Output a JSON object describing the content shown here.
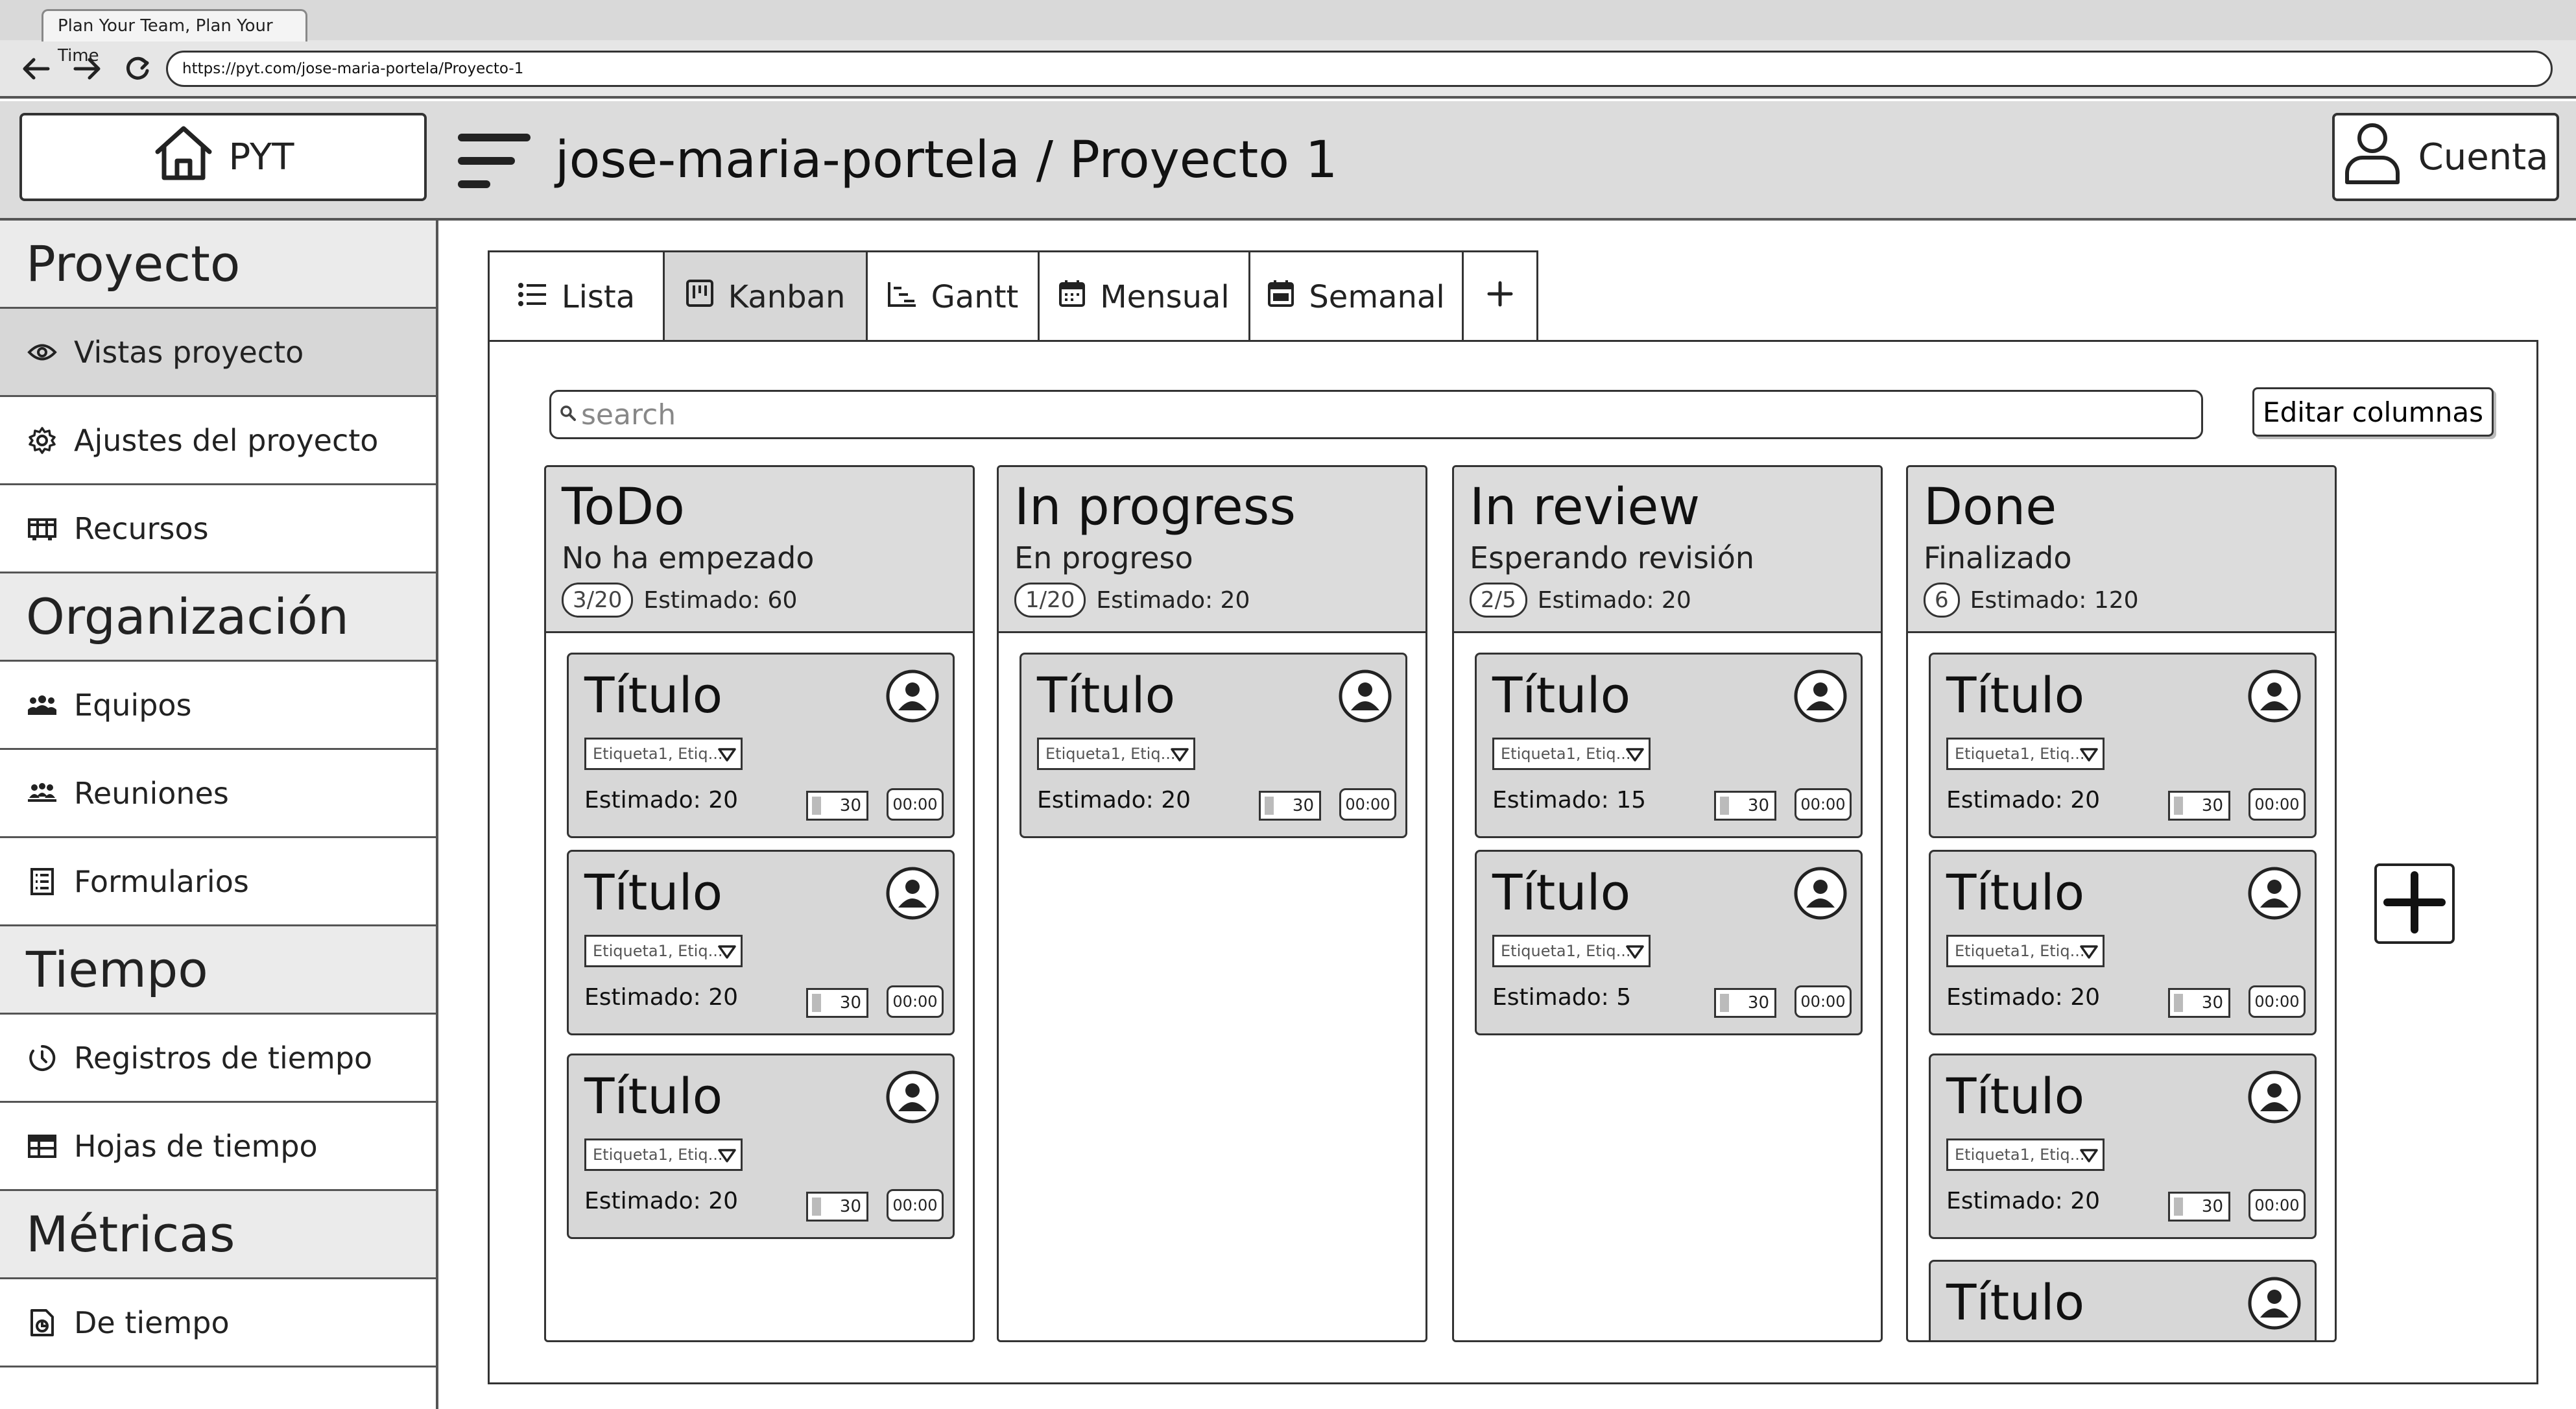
{
  "browser": {
    "tab_title": "Plan Your Team, Plan Your Time",
    "url": "https://pyt.com/jose-maria-portela/Proyecto-1"
  },
  "header": {
    "home_label": "PYT",
    "breadcrumb": "jose-maria-portela / Proyecto 1",
    "account_label": "Cuenta"
  },
  "sidebar": {
    "sections": [
      {
        "title": "Proyecto",
        "items": [
          {
            "label": "Vistas proyecto",
            "icon": "eye-icon",
            "active": true
          },
          {
            "label": "Ajustes del proyecto",
            "icon": "gear-icon"
          },
          {
            "label": "Recursos",
            "icon": "resources-icon"
          }
        ]
      },
      {
        "title": "Organización",
        "items": [
          {
            "label": "Equipos",
            "icon": "teams-icon"
          },
          {
            "label": "Reuniones",
            "icon": "meetings-icon"
          },
          {
            "label": "Formularios",
            "icon": "form-icon"
          }
        ]
      },
      {
        "title": "Tiempo",
        "items": [
          {
            "label": "Registros de tiempo",
            "icon": "timer-icon"
          },
          {
            "label": "Hojas de tiempo",
            "icon": "table-icon"
          }
        ]
      },
      {
        "title": "Métricas",
        "items": [
          {
            "label": "De tiempo",
            "icon": "report-icon"
          }
        ]
      }
    ]
  },
  "view_tabs": [
    {
      "label": "Lista",
      "icon": "list-icon"
    },
    {
      "label": "Kanban",
      "icon": "kanban-icon",
      "active": true
    },
    {
      "label": "Gantt",
      "icon": "gantt-icon"
    },
    {
      "label": "Mensual",
      "icon": "calendar-icon"
    },
    {
      "label": "Semanal",
      "icon": "calendar-week-icon"
    }
  ],
  "board": {
    "search_placeholder": "search",
    "edit_columns_label": "Editar columnas",
    "columns": [
      {
        "title": "ToDo",
        "subtitle": "No ha empezado",
        "count": "3/20",
        "estimate": "Estimado: 60",
        "cards": [
          {
            "title": "Título",
            "tags": "Etiqueta1, Etiq...",
            "estimate": "Estimado: 20",
            "hours": "30",
            "timer": "00:00"
          },
          {
            "title": "Título",
            "tags": "Etiqueta1, Etiq...",
            "estimate": "Estimado: 20",
            "hours": "30",
            "timer": "00:00"
          },
          {
            "title": "Título",
            "tags": "Etiqueta1, Etiq...",
            "estimate": "Estimado: 20",
            "hours": "30",
            "timer": "00:00"
          }
        ]
      },
      {
        "title": "In progress",
        "subtitle": "En progreso",
        "count": "1/20",
        "estimate": "Estimado: 20",
        "cards": [
          {
            "title": "Título",
            "tags": "Etiqueta1, Etiq...",
            "estimate": "Estimado: 20",
            "hours": "30",
            "timer": "00:00"
          }
        ]
      },
      {
        "title": "In review",
        "subtitle": "Esperando revisión",
        "count": "2/5",
        "estimate": "Estimado: 20",
        "cards": [
          {
            "title": "Título",
            "tags": "Etiqueta1, Etiq...",
            "estimate": "Estimado: 15",
            "hours": "30",
            "timer": "00:00"
          },
          {
            "title": "Título",
            "tags": "Etiqueta1, Etiq...",
            "estimate": "Estimado: 5",
            "hours": "30",
            "timer": "00:00"
          }
        ]
      },
      {
        "title": "Done",
        "subtitle": "Finalizado",
        "count": "6",
        "estimate": "Estimado: 120",
        "cards": [
          {
            "title": "Título",
            "tags": "Etiqueta1, Etiq...",
            "estimate": "Estimado: 20",
            "hours": "30",
            "timer": "00:00"
          },
          {
            "title": "Título",
            "tags": "Etiqueta1, Etiq...",
            "estimate": "Estimado: 20",
            "hours": "30",
            "timer": "00:00"
          },
          {
            "title": "Título",
            "tags": "Etiqueta1, Etiq...",
            "estimate": "Estimado: 20",
            "hours": "30",
            "timer": "00:00"
          },
          {
            "title": "Título",
            "tags": "",
            "estimate": "",
            "hours": "",
            "timer": ""
          }
        ]
      }
    ]
  }
}
